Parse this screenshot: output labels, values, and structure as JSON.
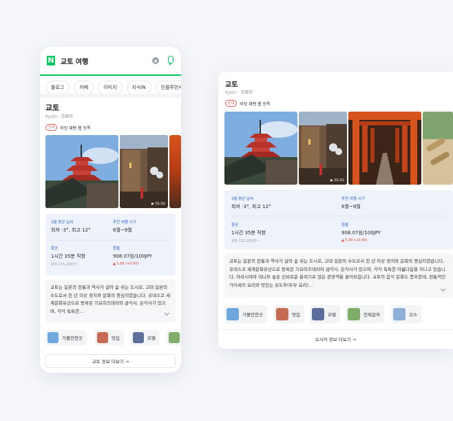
{
  "search": {
    "query": "교토 여행",
    "logo": "N"
  },
  "tabs": [
    "블로그",
    "카페",
    "이미지",
    "지식iN",
    "인플루언서"
  ],
  "place": {
    "title": "교토",
    "subtitle": "Kyoto · 京都市",
    "visa_badge": "안내",
    "visa_text": "비짓 재팬 웹 등록"
  },
  "video_duration": "▶ 01:02",
  "info": {
    "weather_label": "3월 평균 날씨",
    "weather_value": "최저 -3°, 최고 12°",
    "season_label": "추천 여행 시기",
    "season_value": "6월~9월",
    "flight_label": "항공",
    "flight_value": "1시간 35분 직항",
    "flight_note": "왕복 131,200원~",
    "exchange_label": "환율",
    "exchange_value": "908.07원/100JPY",
    "exchange_delta": "▲ 5.89 (+0.60)"
  },
  "description_mobile": "교토는 일본의 전통과 역사가 살아 숨 쉬는 도시로, 고대 일본의 수도로서 천 년 이상 정치와 문화의 중심지였습니다. 유네스코 세계문화유산으로 등록된 기요미즈데라와 금각사, 은각사가 있으며, 각각 독특한…",
  "description_desktop": "교토는 일본의 전통과 역사가 살아 숨 쉬는 도시로, 고대 일본의 수도로서 천 년 이상 정치와 문화의 중심지였습니다. 유네스코 세계문화유산으로 등록된 기요미즈데라와 금각사, 은각사가 있으며, 각각 독특한 아름다움을 지니고 있습니다. 아라시야마 대나무 숲은 신비로운 분위기로 많은 관광객을 끌어모읍니다. 교토의 음식 문화도 풍부한데, 전통적인 가이세키 요리와 맛있는 유도후(두부 요리)…",
  "chips": [
    "가볼만한곳",
    "맛집",
    "호텔",
    "언제갈까",
    "코스"
  ],
  "more_mobile": "교토 정보 더보기 →",
  "more_desktop": "오사카 정보 더보기 →",
  "colors": {
    "naver_green": "#03c75a",
    "info_bg": "#eef3fb",
    "label_blue": "#2a62c9",
    "delta_red": "#e0463c"
  }
}
